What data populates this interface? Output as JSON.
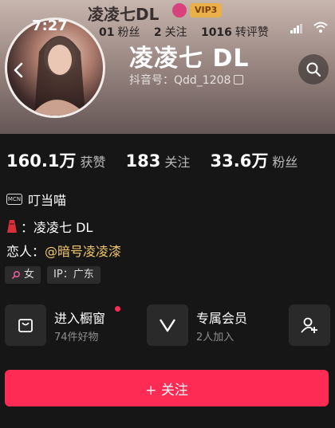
{
  "status_bar": {
    "time": "7:27"
  },
  "ghost_header": {
    "name": "凌凌七DL",
    "vip_label": "VIP3",
    "stats": [
      {
        "value": "01",
        "label": "粉丝"
      },
      {
        "value": "2",
        "label": "关注"
      },
      {
        "value": "1016",
        "label": "转评赞"
      }
    ]
  },
  "profile": {
    "name": "凌凌七 DL",
    "douyin_id": "抖音号：Qdd_1208"
  },
  "stats": [
    {
      "value": "160.1万",
      "label": "获赞"
    },
    {
      "value": "183",
      "label": "关注"
    },
    {
      "value": "33.6万",
      "label": "粉丝"
    }
  ],
  "bio": {
    "mcn_icon_text": "MCN",
    "mcn_name": "叮当喵",
    "line2_text": "：凌凌七 DL",
    "lover_prefix": "恋人：",
    "lover_mention": "@暗号凌凌漆"
  },
  "tags": {
    "gender": "女",
    "ip": "IP：广东"
  },
  "cards": [
    {
      "title": "进入橱窗",
      "subtitle": "74件好物",
      "icon": "shopping-bag-icon"
    },
    {
      "title": "专属会员",
      "subtitle": "2人加入",
      "icon": "v-member-icon"
    }
  ],
  "follow_button": {
    "label": "+ 关注"
  },
  "colors": {
    "accent": "#fe2c55",
    "mention": "#f1c76a",
    "background": "#161616"
  }
}
